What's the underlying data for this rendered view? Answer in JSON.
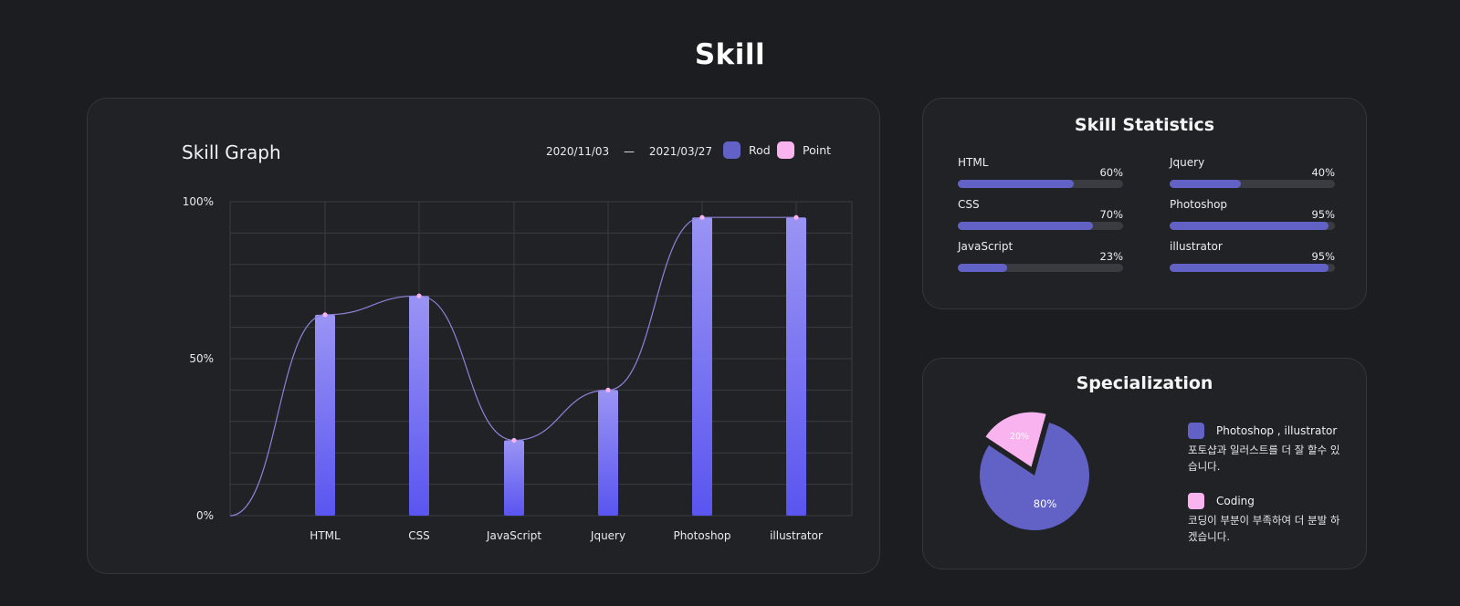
{
  "page": {
    "title": "Skill"
  },
  "colors": {
    "rod": "#6262c6",
    "rod_gradient_top": "#9a94f4",
    "rod_gradient_bottom": "#5a55f0",
    "point": "#f9b3ee",
    "curve": "#8c82d8",
    "grid": "#3a3c42",
    "track": "#3b3c41"
  },
  "graph": {
    "title": "Skill Graph",
    "date_from": "2020/11/03",
    "date_dash": "—",
    "date_to": "2021/03/27",
    "legend": [
      {
        "label": "Rod",
        "color": "#6262c6"
      },
      {
        "label": "Point",
        "color": "#f9b3ee"
      }
    ]
  },
  "chart_data": [
    {
      "type": "bar",
      "title": "Skill Graph",
      "categories": [
        "HTML",
        "CSS",
        "JavaScript",
        "Jquery",
        "Photoshop",
        "illustrator"
      ],
      "series": [
        {
          "name": "Rod",
          "values": [
            64,
            70,
            24,
            40,
            95,
            95
          ]
        },
        {
          "name": "Point",
          "values": [
            64,
            70,
            24,
            40,
            95,
            95
          ]
        }
      ],
      "curve_start": 0,
      "ylim": [
        0,
        100
      ],
      "yticks": [
        "0%",
        "50%",
        "100%"
      ],
      "grid": true,
      "legend_position": "top-right"
    },
    {
      "type": "pie",
      "title": "Specialization",
      "labels": [
        "Photoshop , illustrator",
        "Coding"
      ],
      "values": [
        80,
        20
      ],
      "value_labels": [
        "80%",
        "20%"
      ],
      "colors": [
        "#6262c6",
        "#f9b3ee"
      ]
    }
  ],
  "stats": {
    "title": "Skill Statistics",
    "items": [
      {
        "name": "HTML",
        "percent": 70,
        "percent_label": "60%"
      },
      {
        "name": "CSS",
        "percent": 82,
        "percent_label": "70%"
      },
      {
        "name": "JavaScript",
        "percent": 30,
        "percent_label": "23%"
      },
      {
        "name": "Jquery",
        "percent": 43,
        "percent_label": "40%"
      },
      {
        "name": "Photoshop",
        "percent": 96,
        "percent_label": "95%"
      },
      {
        "name": "illustrator",
        "percent": 96,
        "percent_label": "95%"
      }
    ]
  },
  "specialization": {
    "title": "Specialization",
    "legend": [
      {
        "label": "Photoshop , illustrator",
        "desc": "포토샵과 일러스트를 더 잘 할수 있습니다.",
        "color": "#6262c6"
      },
      {
        "label": "Coding",
        "desc": "코딩이 부분이 부족하여 더 분발 하겠습니다.",
        "color": "#f9b3ee"
      }
    ]
  }
}
